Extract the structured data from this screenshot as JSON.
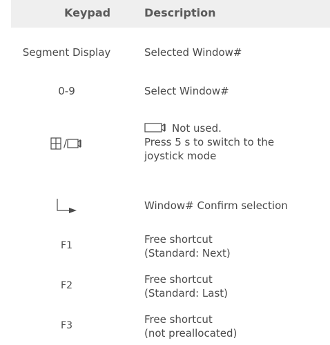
{
  "header": {
    "keypad": "Keypad",
    "description": "Description"
  },
  "rows": [
    {
      "keypad": "Segment Display",
      "description": [
        "Selected Window#"
      ]
    },
    {
      "keypad": "0-9",
      "description": [
        "Select Window#"
      ]
    },
    {
      "keypad_icon": [
        "grid-icon",
        "camera-icon"
      ],
      "keypad_separator": "/",
      "description_icon": "camera-icon",
      "description": [
        "Not used.",
        "Press 5 s to switch to the",
        "joystick mode"
      ]
    },
    {
      "keypad_icon": [
        "enter-arrow-icon"
      ],
      "description": [
        "Window# Confirm selection"
      ]
    },
    {
      "keypad": "F1",
      "description": [
        "Free shortcut",
        "(Standard: Next)"
      ]
    },
    {
      "keypad": "F2",
      "description": [
        "Free shortcut",
        "(Standard: Last)"
      ]
    },
    {
      "keypad": "F3",
      "description": [
        "Free shortcut",
        "(not preallocated)"
      ]
    }
  ]
}
